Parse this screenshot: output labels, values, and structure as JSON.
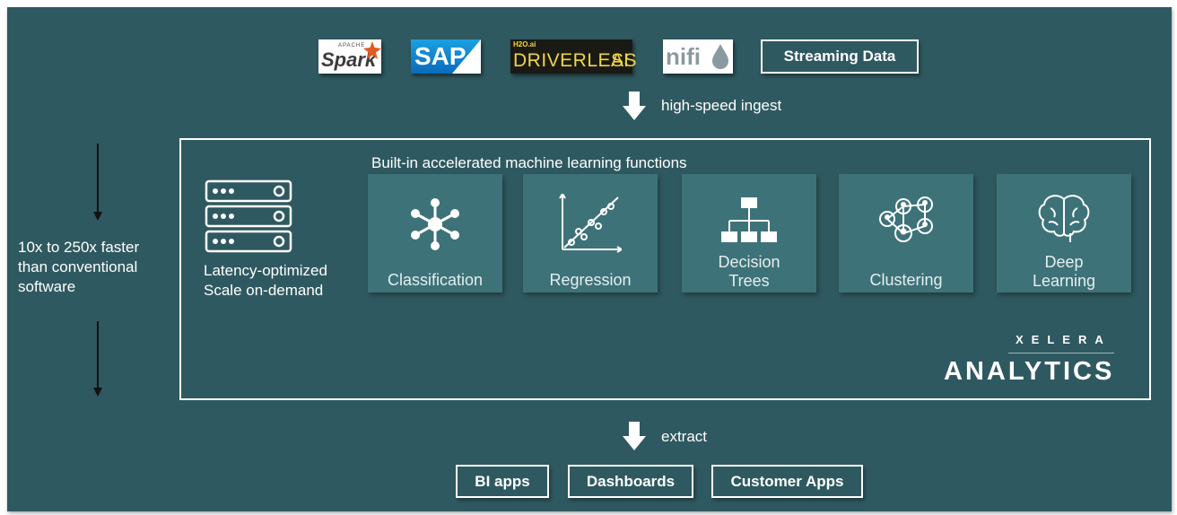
{
  "sources": {
    "spark": {
      "small": "APACHE",
      "main": "Spark"
    },
    "sap": {
      "text": "SAP"
    },
    "driverless": {
      "badge": "H2O.ai",
      "main": "DRIVERLESS",
      "suffix": "AI"
    },
    "nifi": {
      "text": "nifi"
    },
    "streaming": {
      "label": "Streaming Data"
    }
  },
  "ingest": {
    "label": "high-speed ingest"
  },
  "speed": {
    "text": "10x to 250x faster\nthan conventional\nsoftware"
  },
  "engine": {
    "heading": "Built-in accelerated machine learning functions",
    "server_caption": "Latency-optimized\nScale on-demand",
    "functions": [
      {
        "label": "Classification",
        "icon": "hub-network-icon"
      },
      {
        "label": "Regression",
        "icon": "scatter-trend-icon"
      },
      {
        "label": "Decision\nTrees",
        "icon": "org-tree-icon"
      },
      {
        "label": "Clustering",
        "icon": "people-cluster-icon"
      },
      {
        "label": "Deep\nLearning",
        "icon": "brain-icon"
      }
    ],
    "brand": {
      "top": "XELERA",
      "bottom": "ANALYTICS"
    }
  },
  "extract": {
    "label": "extract"
  },
  "outputs": [
    {
      "label": "BI apps"
    },
    {
      "label": "Dashboards"
    },
    {
      "label": "Customer Apps"
    }
  ],
  "colors": {
    "background": "#2f5960",
    "tile": "#3d7279",
    "foreground": "#ffffff"
  }
}
